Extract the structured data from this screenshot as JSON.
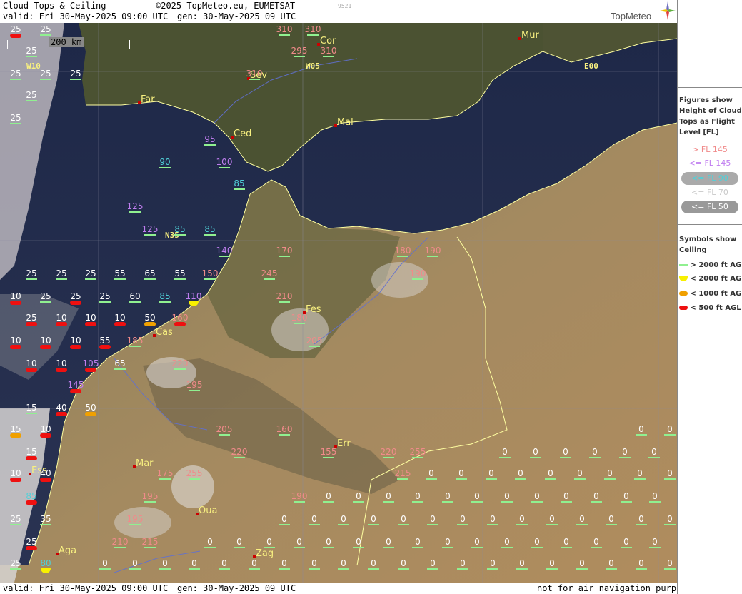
{
  "header": {
    "title": "Cloud Tops & Ceiling",
    "copyright": "©2025 TopMeteo.eu, EUMETSAT",
    "valid": "valid:  Fri  30-May-2025  09:00 UTC",
    "gen": "gen: 30-May-2025 09 UTC",
    "id": "9521",
    "brand": "TopMeteo"
  },
  "footer": {
    "valid": "valid:  Fri  30-May-2025  09:00 UTC",
    "gen": "gen: 30-May-2025 09 UTC",
    "disclaimer": "not for air navigation purposes"
  },
  "scale_label": "200 km",
  "grid_labels": {
    "w10": "W10",
    "w05": "W05",
    "e00": "E00",
    "n35": "N35"
  },
  "cities": [
    {
      "name": "Cor"
    },
    {
      "name": "Mur"
    },
    {
      "name": "Sev"
    },
    {
      "name": "Far"
    },
    {
      "name": "Ced"
    },
    {
      "name": "Mal"
    },
    {
      "name": "Fes"
    },
    {
      "name": "Cas"
    },
    {
      "name": "Err"
    },
    {
      "name": "Mar"
    },
    {
      "name": "Ess"
    },
    {
      "name": "Oua"
    },
    {
      "name": "Aga"
    },
    {
      "name": "Zag"
    }
  ],
  "colors": {
    "high": "#f08a8a",
    "mid": "#c07ef0",
    "low90": "#50d0d8",
    "low70": "#c8c8c8",
    "low50": "#ffffff",
    "zero": "#ffffff",
    "green": "#90f090",
    "yellow": "#f8f000",
    "orange": "#f0a000",
    "red": "#ee1010",
    "city": "#f8f080"
  },
  "legend": {
    "figures_title": "Figures show Height of Cloud Tops as Flight Level  [FL]",
    "fl_items": [
      "> FL 145",
      "<= FL 145",
      "<= FL 90",
      "<= FL 70",
      "<= FL 50"
    ],
    "symbols_title": "Symbols show Ceiling",
    "ceiling_items": [
      "> 2000 ft AGL",
      "< 2000 ft AGL",
      "< 1000 ft AGL",
      "< 500 ft AGL"
    ]
  },
  "observations": [
    {
      "v": "25",
      "c": "white",
      "s": "red"
    },
    {
      "v": "25",
      "c": "white",
      "s": "green"
    },
    {
      "v": "310",
      "c": "high",
      "s": "green"
    },
    {
      "v": "310",
      "c": "high",
      "s": "green"
    },
    {
      "v": "25",
      "c": "white",
      "s": "green"
    },
    {
      "v": "295",
      "c": "high",
      "s": "green"
    },
    {
      "v": "310",
      "c": "high",
      "s": "green"
    },
    {
      "v": "25",
      "c": "white",
      "s": "green"
    },
    {
      "v": "25",
      "c": "white",
      "s": "green"
    },
    {
      "v": "25",
      "c": "white",
      "s": "green"
    },
    {
      "v": "310",
      "c": "high",
      "s": "green"
    },
    {
      "v": "25",
      "c": "white",
      "s": "green"
    },
    {
      "v": "25",
      "c": "white",
      "s": "green"
    },
    {
      "v": "95",
      "c": "mid",
      "s": "green"
    },
    {
      "v": "90",
      "c": "low90",
      "s": "green"
    },
    {
      "v": "100",
      "c": "mid",
      "s": "green"
    },
    {
      "v": "85",
      "c": "low90",
      "s": "green"
    },
    {
      "v": "125",
      "c": "mid",
      "s": "green"
    },
    {
      "v": "125",
      "c": "mid",
      "s": "green"
    },
    {
      "v": "85",
      "c": "low90",
      "s": "green"
    },
    {
      "v": "85",
      "c": "low90",
      "s": "green"
    },
    {
      "v": "140",
      "c": "mid",
      "s": "green"
    },
    {
      "v": "170",
      "c": "high",
      "s": "green"
    },
    {
      "v": "180",
      "c": "high",
      "s": "green"
    },
    {
      "v": "190",
      "c": "high",
      "s": "green"
    },
    {
      "v": "25",
      "c": "white",
      "s": "green"
    },
    {
      "v": "25",
      "c": "white",
      "s": "green"
    },
    {
      "v": "25",
      "c": "white",
      "s": "green"
    },
    {
      "v": "55",
      "c": "white",
      "s": "green"
    },
    {
      "v": "65",
      "c": "white",
      "s": "green"
    },
    {
      "v": "55",
      "c": "white",
      "s": "green"
    },
    {
      "v": "150",
      "c": "high",
      "s": "green"
    },
    {
      "v": "245",
      "c": "high",
      "s": "green"
    },
    {
      "v": "190",
      "c": "high",
      "s": "green"
    },
    {
      "v": "10",
      "c": "white",
      "s": "red"
    },
    {
      "v": "25",
      "c": "white",
      "s": "green"
    },
    {
      "v": "25",
      "c": "white",
      "s": "red"
    },
    {
      "v": "25",
      "c": "white",
      "s": "green"
    },
    {
      "v": "60",
      "c": "white",
      "s": "green"
    },
    {
      "v": "85",
      "c": "low90",
      "s": "green"
    },
    {
      "v": "110",
      "c": "mid",
      "s": "yellow"
    },
    {
      "v": "210",
      "c": "high",
      "s": "green"
    },
    {
      "v": "25",
      "c": "white",
      "s": "red"
    },
    {
      "v": "10",
      "c": "white",
      "s": "red"
    },
    {
      "v": "10",
      "c": "white",
      "s": "red"
    },
    {
      "v": "10",
      "c": "white",
      "s": "red"
    },
    {
      "v": "50",
      "c": "white",
      "s": "orange"
    },
    {
      "v": "160",
      "c": "high",
      "s": "red"
    },
    {
      "v": "180",
      "c": "high",
      "s": "green"
    },
    {
      "v": "10",
      "c": "white",
      "s": "red"
    },
    {
      "v": "10",
      "c": "white",
      "s": "red"
    },
    {
      "v": "10",
      "c": "white",
      "s": "red"
    },
    {
      "v": "55",
      "c": "white",
      "s": "red"
    },
    {
      "v": "185",
      "c": "high",
      "s": "green"
    },
    {
      "v": "205",
      "c": "high",
      "s": "green"
    },
    {
      "v": "10",
      "c": "white",
      "s": "red"
    },
    {
      "v": "10",
      "c": "white",
      "s": "red"
    },
    {
      "v": "105",
      "c": "mid",
      "s": "red"
    },
    {
      "v": "65",
      "c": "white",
      "s": "green"
    },
    {
      "v": "220",
      "c": "high",
      "s": "green"
    },
    {
      "v": "145",
      "c": "mid",
      "s": "red"
    },
    {
      "v": "195",
      "c": "high",
      "s": "green"
    },
    {
      "v": "15",
      "c": "white",
      "s": "green"
    },
    {
      "v": "40",
      "c": "white",
      "s": "red"
    },
    {
      "v": "50",
      "c": "white",
      "s": "orange"
    },
    {
      "v": "15",
      "c": "white",
      "s": "orange"
    },
    {
      "v": "10",
      "c": "white",
      "s": "red"
    },
    {
      "v": "205",
      "c": "high",
      "s": "green"
    },
    {
      "v": "160",
      "c": "high",
      "s": "green"
    },
    {
      "v": "0",
      "c": "white",
      "s": "green"
    },
    {
      "v": "0",
      "c": "white",
      "s": "green"
    },
    {
      "v": "15",
      "c": "white",
      "s": "red"
    },
    {
      "v": "220",
      "c": "high",
      "s": "green"
    },
    {
      "v": "155",
      "c": "high",
      "s": "green"
    },
    {
      "v": "220",
      "c": "high",
      "s": "green"
    },
    {
      "v": "255",
      "c": "high",
      "s": "green"
    },
    {
      "v": "10",
      "c": "white",
      "s": "red"
    },
    {
      "v": "40",
      "c": "white",
      "s": "red"
    },
    {
      "v": "175",
      "c": "high",
      "s": "green"
    },
    {
      "v": "255",
      "c": "high",
      "s": "green"
    },
    {
      "v": "215",
      "c": "high",
      "s": "green"
    },
    {
      "v": "85",
      "c": "low90",
      "s": "red"
    },
    {
      "v": "195",
      "c": "high",
      "s": "green"
    },
    {
      "v": "190",
      "c": "high",
      "s": "green"
    },
    {
      "v": "25",
      "c": "white",
      "s": "green"
    },
    {
      "v": "35",
      "c": "white",
      "s": "green"
    },
    {
      "v": "195",
      "c": "high",
      "s": "green"
    },
    {
      "v": "25",
      "c": "white",
      "s": "red"
    },
    {
      "v": "210",
      "c": "high",
      "s": "green"
    },
    {
      "v": "215",
      "c": "high",
      "s": "green"
    },
    {
      "v": "25",
      "c": "white",
      "s": "green"
    },
    {
      "v": "80",
      "c": "low90",
      "s": "yellow"
    }
  ],
  "zero_grid": {
    "value": "0"
  }
}
